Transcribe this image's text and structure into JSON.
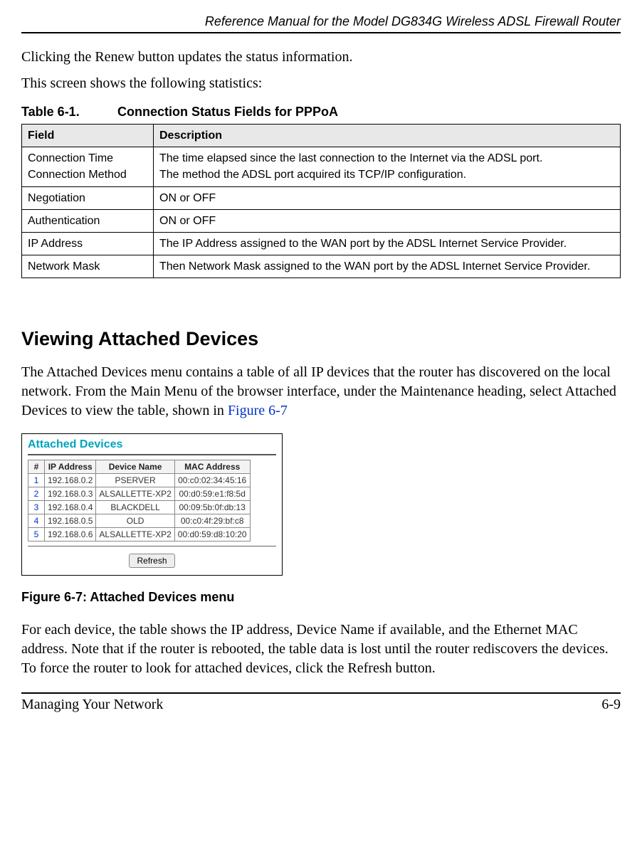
{
  "header": {
    "title": "Reference Manual for the Model DG834G Wireless ADSL Firewall Router"
  },
  "intro": {
    "p1": "Clicking the Renew button updates the status information.",
    "p2": "This screen shows the following statistics:"
  },
  "table61": {
    "label": "Table 6-1.",
    "title": "Connection Status Fields for PPPoA",
    "headers": {
      "field": "Field",
      "desc": "Description"
    },
    "rows": [
      {
        "field1": "Connection Time",
        "field2": "Connection Method",
        "desc1": "The time elapsed since the last connection to the Internet via the ADSL port.",
        "desc2": "The method the ADSL port acquired its TCP/IP configuration."
      },
      {
        "field": "Negotiation",
        "desc": "ON or OFF"
      },
      {
        "field": "Authentication",
        "desc": "ON or OFF"
      },
      {
        "field": "IP Address",
        "desc": "The IP Address assigned to the WAN port by the ADSL Internet Service Provider."
      },
      {
        "field": "Network Mask",
        "desc": "Then Network Mask assigned to the WAN port by the ADSL Internet Service Provider."
      }
    ]
  },
  "section": {
    "heading": "Viewing Attached Devices",
    "p1a": "The Attached Devices menu contains a table of all IP devices that the router has discovered on the local network. From the Main Menu of the browser interface, under the Maintenance heading, select Attached Devices to view the table, shown in ",
    "figref": "Figure 6-7",
    "p2": "For each device, the table shows the IP address, Device Name if available, and the Ethernet MAC address. Note that if the router is rebooted, the table data is lost until the router rediscovers the devices. To force the router to look for attached devices, click the Refresh button."
  },
  "figure": {
    "title": "Attached Devices",
    "headers": {
      "hash": "#",
      "ip": "IP Address",
      "name": "Device Name",
      "mac": "MAC Address"
    },
    "rows": [
      {
        "n": "1",
        "ip": "192.168.0.2",
        "name": "PSERVER",
        "mac": "00:c0:02:34:45:16"
      },
      {
        "n": "2",
        "ip": "192.168.0.3",
        "name": "ALSALLETTE-XP2",
        "mac": "00:d0:59:e1:f8:5d"
      },
      {
        "n": "3",
        "ip": "192.168.0.4",
        "name": "BLACKDELL",
        "mac": "00:09:5b:0f:db:13"
      },
      {
        "n": "4",
        "ip": "192.168.0.5",
        "name": "OLD",
        "mac": "00:c0:4f:29:bf:c8"
      },
      {
        "n": "5",
        "ip": "192.168.0.6",
        "name": "ALSALLETTE-XP2",
        "mac": "00:d0:59:d8:10:20"
      }
    ],
    "refresh": "Refresh",
    "caption": "Figure 6-7:  Attached Devices menu"
  },
  "footer": {
    "left": "Managing Your Network",
    "right": "6-9"
  }
}
